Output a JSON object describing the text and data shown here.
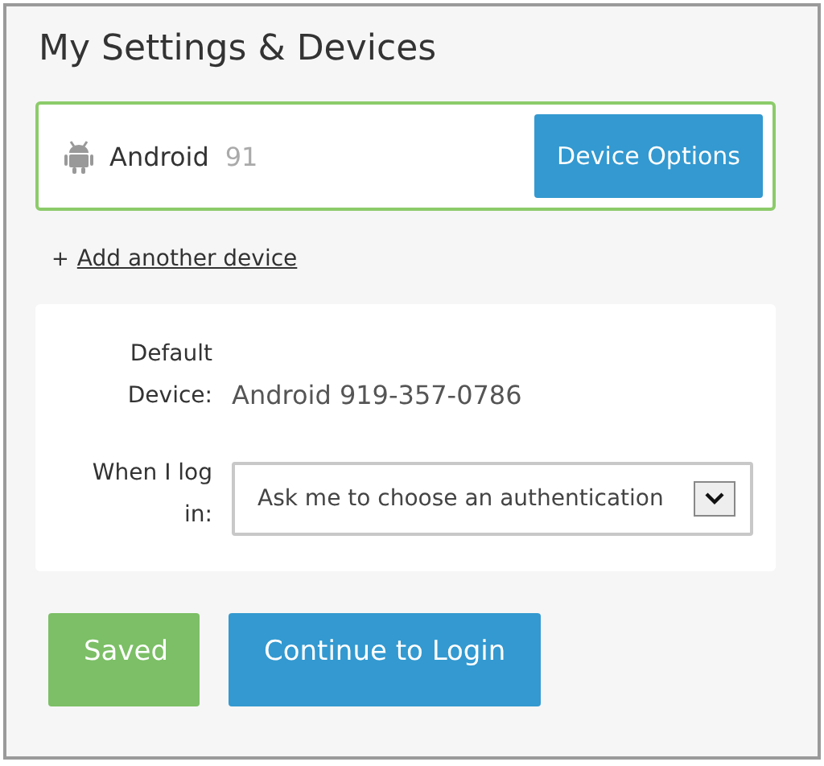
{
  "title": "My Settings & Devices",
  "device": {
    "name": "Android",
    "number": "91",
    "selected": true,
    "button": "Device Options"
  },
  "add_link": {
    "prefix": "+",
    "label": "Add another device"
  },
  "settings": {
    "default_device_label": "Default Device:",
    "default_device_value": "Android 919-357-0786",
    "login_label": "When I log in:",
    "login_value": "Ask me to choose an authentication"
  },
  "buttons": [
    {
      "label": "Saved",
      "kind": "success"
    },
    {
      "label": "Continue to Login",
      "kind": "primary"
    }
  ]
}
